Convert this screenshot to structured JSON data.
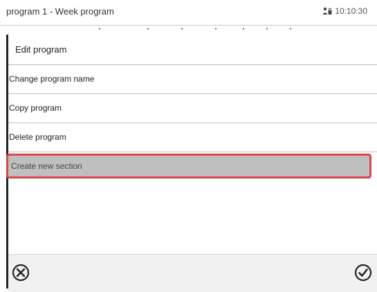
{
  "titlebar": {
    "title": "program 1 - Week program",
    "time": "10:10:30",
    "status_icon": "user-lock-icon"
  },
  "menu": {
    "header": "Edit program",
    "items": [
      {
        "label": "Change program name"
      },
      {
        "label": "Copy program"
      },
      {
        "label": "Delete program"
      },
      {
        "label": "Create new section",
        "selected": true
      }
    ]
  },
  "bottombar": {
    "cancel_icon": "cancel-icon",
    "confirm_icon": "confirm-icon"
  },
  "colors": {
    "selection_fill": "#bfbfbf",
    "selection_border": "#d9474d",
    "bottom_bar": "#f1f1f1"
  }
}
